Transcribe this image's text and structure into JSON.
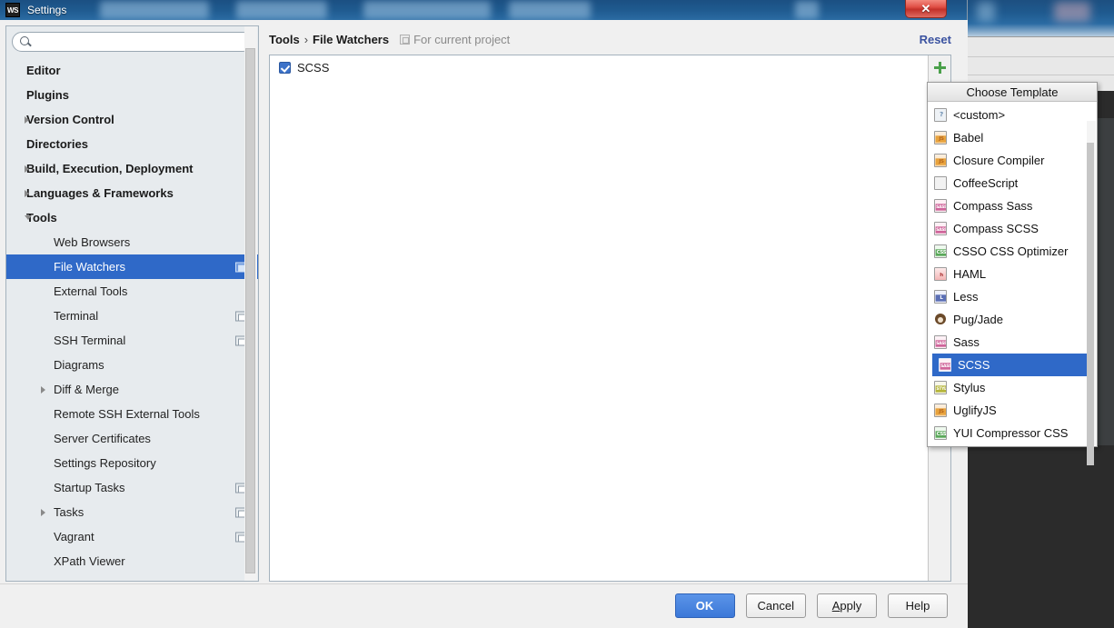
{
  "window": {
    "title": "Settings",
    "app_icon": "WS",
    "close_label": "✕"
  },
  "sidebar": {
    "search": {
      "value": "",
      "placeholder": ""
    },
    "items": [
      {
        "label": "Editor",
        "level": "root",
        "arrow": "none",
        "badge": false
      },
      {
        "label": "Plugins",
        "level": "root",
        "arrow": "none",
        "badge": false
      },
      {
        "label": "Version Control",
        "level": "root",
        "arrow": "collapsed",
        "badge": false
      },
      {
        "label": "Directories",
        "level": "root",
        "arrow": "none",
        "badge": false
      },
      {
        "label": "Build, Execution, Deployment",
        "level": "root",
        "arrow": "collapsed",
        "badge": false
      },
      {
        "label": "Languages & Frameworks",
        "level": "root",
        "arrow": "collapsed",
        "badge": false
      },
      {
        "label": "Tools",
        "level": "root",
        "arrow": "expanded",
        "badge": false
      },
      {
        "label": "Web Browsers",
        "level": "child",
        "arrow": "none",
        "badge": false
      },
      {
        "label": "File Watchers",
        "level": "child",
        "arrow": "none",
        "badge": true,
        "selected": true
      },
      {
        "label": "External Tools",
        "level": "child",
        "arrow": "none",
        "badge": false
      },
      {
        "label": "Terminal",
        "level": "child",
        "arrow": "none",
        "badge": true
      },
      {
        "label": "SSH Terminal",
        "level": "child",
        "arrow": "none",
        "badge": true
      },
      {
        "label": "Diagrams",
        "level": "child",
        "arrow": "none",
        "badge": false
      },
      {
        "label": "Diff & Merge",
        "level": "child",
        "arrow": "collapsed",
        "badge": false
      },
      {
        "label": "Remote SSH External Tools",
        "level": "child",
        "arrow": "none",
        "badge": false
      },
      {
        "label": "Server Certificates",
        "level": "child",
        "arrow": "none",
        "badge": false
      },
      {
        "label": "Settings Repository",
        "level": "child",
        "arrow": "none",
        "badge": false
      },
      {
        "label": "Startup Tasks",
        "level": "child",
        "arrow": "none",
        "badge": true
      },
      {
        "label": "Tasks",
        "level": "child",
        "arrow": "collapsed",
        "badge": true
      },
      {
        "label": "Vagrant",
        "level": "child",
        "arrow": "none",
        "badge": true
      },
      {
        "label": "XPath Viewer",
        "level": "child",
        "arrow": "none",
        "badge": false
      }
    ]
  },
  "main": {
    "breadcrumb": {
      "parent": "Tools",
      "separator": "›",
      "current": "File Watchers"
    },
    "scope_label": "For current project",
    "reset_label": "Reset",
    "watchers": [
      {
        "name": "SCSS",
        "enabled": true
      }
    ],
    "add_button_tooltip": "+"
  },
  "choose_template": {
    "title": "Choose Template",
    "items": [
      {
        "label": "<custom>",
        "icon": "custom-file-icon",
        "icon_class": "custom",
        "tag": "?"
      },
      {
        "label": "Babel",
        "icon": "javascript-file-icon",
        "icon_class": "js",
        "tag": "JS"
      },
      {
        "label": "Closure Compiler",
        "icon": "javascript-file-icon",
        "icon_class": "js",
        "tag": "JS"
      },
      {
        "label": "CoffeeScript",
        "icon": "coffeescript-icon",
        "icon_class": "coffee",
        "tag": ""
      },
      {
        "label": "Compass Sass",
        "icon": "sass-file-icon",
        "icon_class": "sass",
        "tag": "SASS"
      },
      {
        "label": "Compass SCSS",
        "icon": "sass-file-icon",
        "icon_class": "sass",
        "tag": "SASS"
      },
      {
        "label": "CSSO CSS Optimizer",
        "icon": "css-file-icon",
        "icon_class": "css",
        "tag": "CSS"
      },
      {
        "label": "HAML",
        "icon": "haml-file-icon",
        "icon_class": "haml",
        "tag": "h"
      },
      {
        "label": "Less",
        "icon": "less-file-icon",
        "icon_class": "less",
        "tag": "L"
      },
      {
        "label": "Pug/Jade",
        "icon": "pug-icon",
        "icon_class": "pug",
        "tag": ""
      },
      {
        "label": "Sass",
        "icon": "sass-file-icon",
        "icon_class": "sass",
        "tag": "SASS"
      },
      {
        "label": "SCSS",
        "icon": "sass-file-icon",
        "icon_class": "sass",
        "tag": "SASS",
        "selected": true
      },
      {
        "label": "Stylus",
        "icon": "stylus-file-icon",
        "icon_class": "stylus",
        "tag": "STYL"
      },
      {
        "label": "UglifyJS",
        "icon": "javascript-file-icon",
        "icon_class": "js",
        "tag": "JS"
      },
      {
        "label": "YUI Compressor CSS",
        "icon": "css-file-icon",
        "icon_class": "css",
        "tag": "CSS"
      }
    ]
  },
  "footer": {
    "ok": "OK",
    "cancel": "Cancel",
    "apply_pre": "A",
    "apply_mnemonic": "A",
    "apply_rest": "pply",
    "apply": "Apply",
    "help": "Help"
  },
  "colors": {
    "selection_blue": "#2f69c8",
    "primary_button": "#3b78d8",
    "link_blue": "#3a52a0",
    "plus_green": "#4aa04a",
    "titlebar_blue": "#1f5a8f"
  }
}
